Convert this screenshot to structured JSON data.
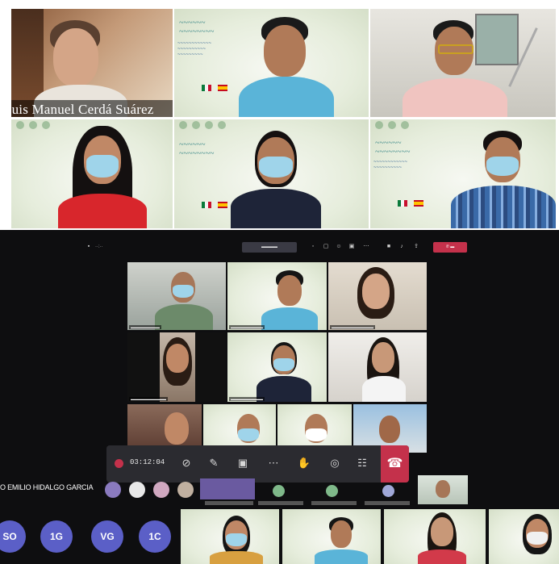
{
  "top_grid": {
    "presenter_name": "Luis Manuel Cerdá Suárez"
  },
  "teams": {
    "call_timer": "03:12:04",
    "icons": {
      "record": "record-icon",
      "camera_off": "camera-off-icon",
      "mic_off": "mic-off-icon",
      "share": "share-icon",
      "more": "more-icon",
      "raise_hand": "raise-hand-icon",
      "chat": "chat-icon",
      "participants": "participants-icon",
      "hangup": "hangup-icon"
    },
    "participant_strip": {
      "pinned_name": "O EMILIO HIDALGO GARCIA"
    },
    "avatars": [
      "SO",
      "1G",
      "VG",
      "1C"
    ]
  },
  "colors": {
    "teams_bg": "#0e0e10",
    "teams_accent": "#5b5fc7",
    "leave_red": "#c4314b",
    "mask_blue": "#9fd4ea"
  }
}
